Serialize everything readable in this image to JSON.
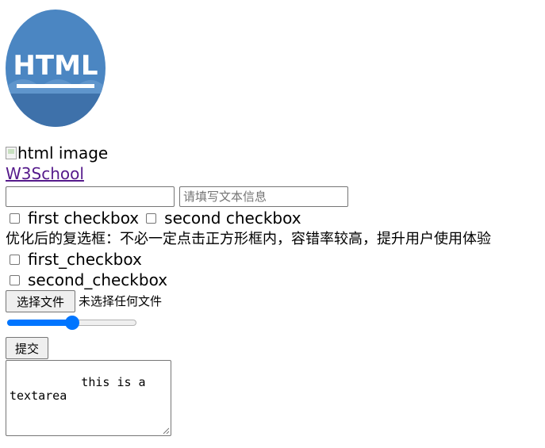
{
  "logo": {
    "text": "HTML",
    "bg_color": "#4a84bf",
    "dark_color": "#3d6fa8"
  },
  "broken_image": {
    "alt": "html image"
  },
  "link": {
    "text": "W3School"
  },
  "inputs": {
    "first": {
      "value": "",
      "placeholder": ""
    },
    "second": {
      "value": "",
      "placeholder": "请填写文本信息"
    }
  },
  "checkbox_row": {
    "first_label": "first checkbox",
    "second_label": "second checkbox"
  },
  "note": "优化后的复选框：不必一定点击正方形框内，容错率较高，提升用户使用体验",
  "checkboxes_optimized": [
    {
      "label": "first_checkbox",
      "checked": false
    },
    {
      "label": "second_checkbox",
      "checked": false
    }
  ],
  "file_input": {
    "button": "选择文件",
    "status": "未选择任何文件"
  },
  "range": {
    "value": 50,
    "min": 0,
    "max": 100,
    "accent": "#0075ff"
  },
  "submit": {
    "label": "提交"
  },
  "textarea": {
    "value": "        this is a textarea"
  }
}
